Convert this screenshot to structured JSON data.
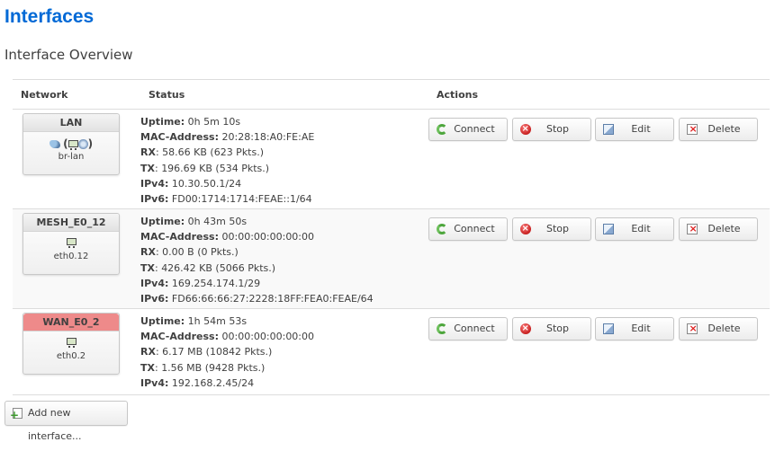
{
  "page_title": "Interfaces",
  "section_title": "Interface Overview",
  "table": {
    "headers": {
      "network": "Network",
      "status": "Status",
      "actions": "Actions"
    }
  },
  "labels": {
    "uptime": "Uptime:",
    "mac": "MAC-Address:",
    "rx": "RX",
    "tx": "TX",
    "ipv4": "IPv4:",
    "ipv6": "IPv6:"
  },
  "buttons": {
    "connect": "Connect",
    "stop": "Stop",
    "edit": "Edit",
    "delete": "Delete",
    "add_new": "Add new interface..."
  },
  "interfaces": [
    {
      "name": "LAN",
      "device": "br-lan",
      "status_color": "#e4e4e4",
      "icons": [
        "bridge-icon",
        "ethernet-icon",
        "wifi-icon"
      ],
      "uptime": "0h 5m 10s",
      "mac": "20:28:18:A0:FE:AE",
      "rx": "58.66 KB (623 Pkts.)",
      "tx": "196.69 KB (534 Pkts.)",
      "ipv4": "10.30.50.1/24",
      "ipv6": "FD00:1714:1714:FEAE::1/64"
    },
    {
      "name": "MESH_E0_12",
      "device": "eth0.12",
      "status_color": "#e4e4e4",
      "icons": [
        "ethernet-icon"
      ],
      "uptime": "0h 43m 50s",
      "mac": "00:00:00:00:00:00",
      "rx": "0.00 B (0 Pkts.)",
      "tx": "426.42 KB (5066 Pkts.)",
      "ipv4": "169.254.174.1/29",
      "ipv6": "FD66:66:66:27:2228:18FF:FEA0:FEAE/64"
    },
    {
      "name": "WAN_E0_2",
      "device": "eth0.2",
      "status_color": "#ee8a8a",
      "icons": [
        "ethernet-icon"
      ],
      "uptime": "1h 54m 53s",
      "mac": "00:00:00:00:00:00",
      "rx": "6.17 MB (10842 Pkts.)",
      "tx": "1.56 MB (9428 Pkts.)",
      "ipv4": "192.168.2.45/24",
      "ipv6": null
    }
  ]
}
